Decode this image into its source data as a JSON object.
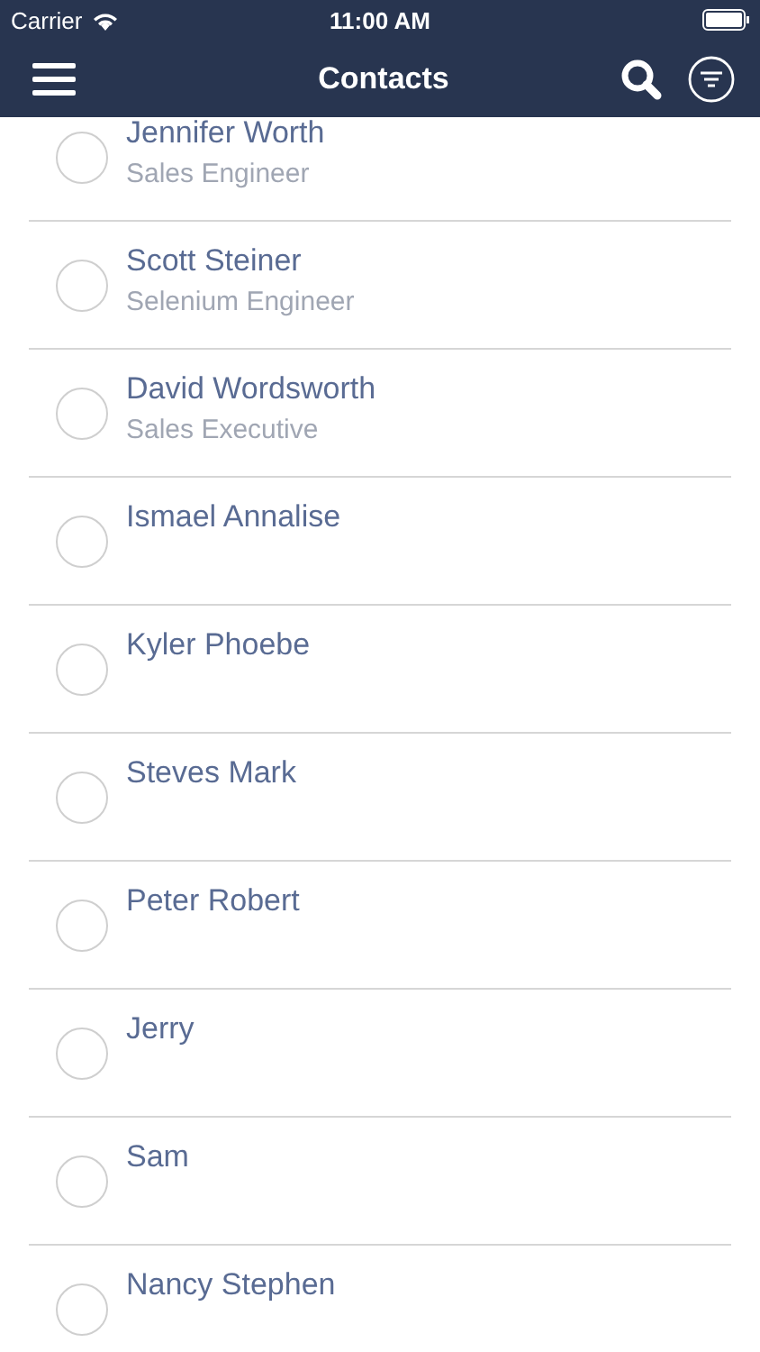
{
  "status_bar": {
    "carrier": "Carrier",
    "time": "11:00 AM"
  },
  "nav_bar": {
    "title": "Contacts"
  },
  "contacts": [
    {
      "name": "Jennifer Worth",
      "title": "Sales Engineer",
      "selected": false
    },
    {
      "name": "Scott Steiner",
      "title": "Selenium Engineer",
      "selected": false
    },
    {
      "name": "David Wordsworth",
      "title": "Sales Executive",
      "selected": false
    },
    {
      "name": "Ismael Annalise",
      "selected": false
    },
    {
      "name": "Kyler Phoebe",
      "selected": false
    },
    {
      "name": "Steves Mark",
      "selected": false
    },
    {
      "name": "Peter Robert",
      "selected": false
    },
    {
      "name": "Jerry",
      "selected": false
    },
    {
      "name": "Sam",
      "selected": false
    },
    {
      "name": "Nancy Stephen",
      "selected": false
    }
  ]
}
